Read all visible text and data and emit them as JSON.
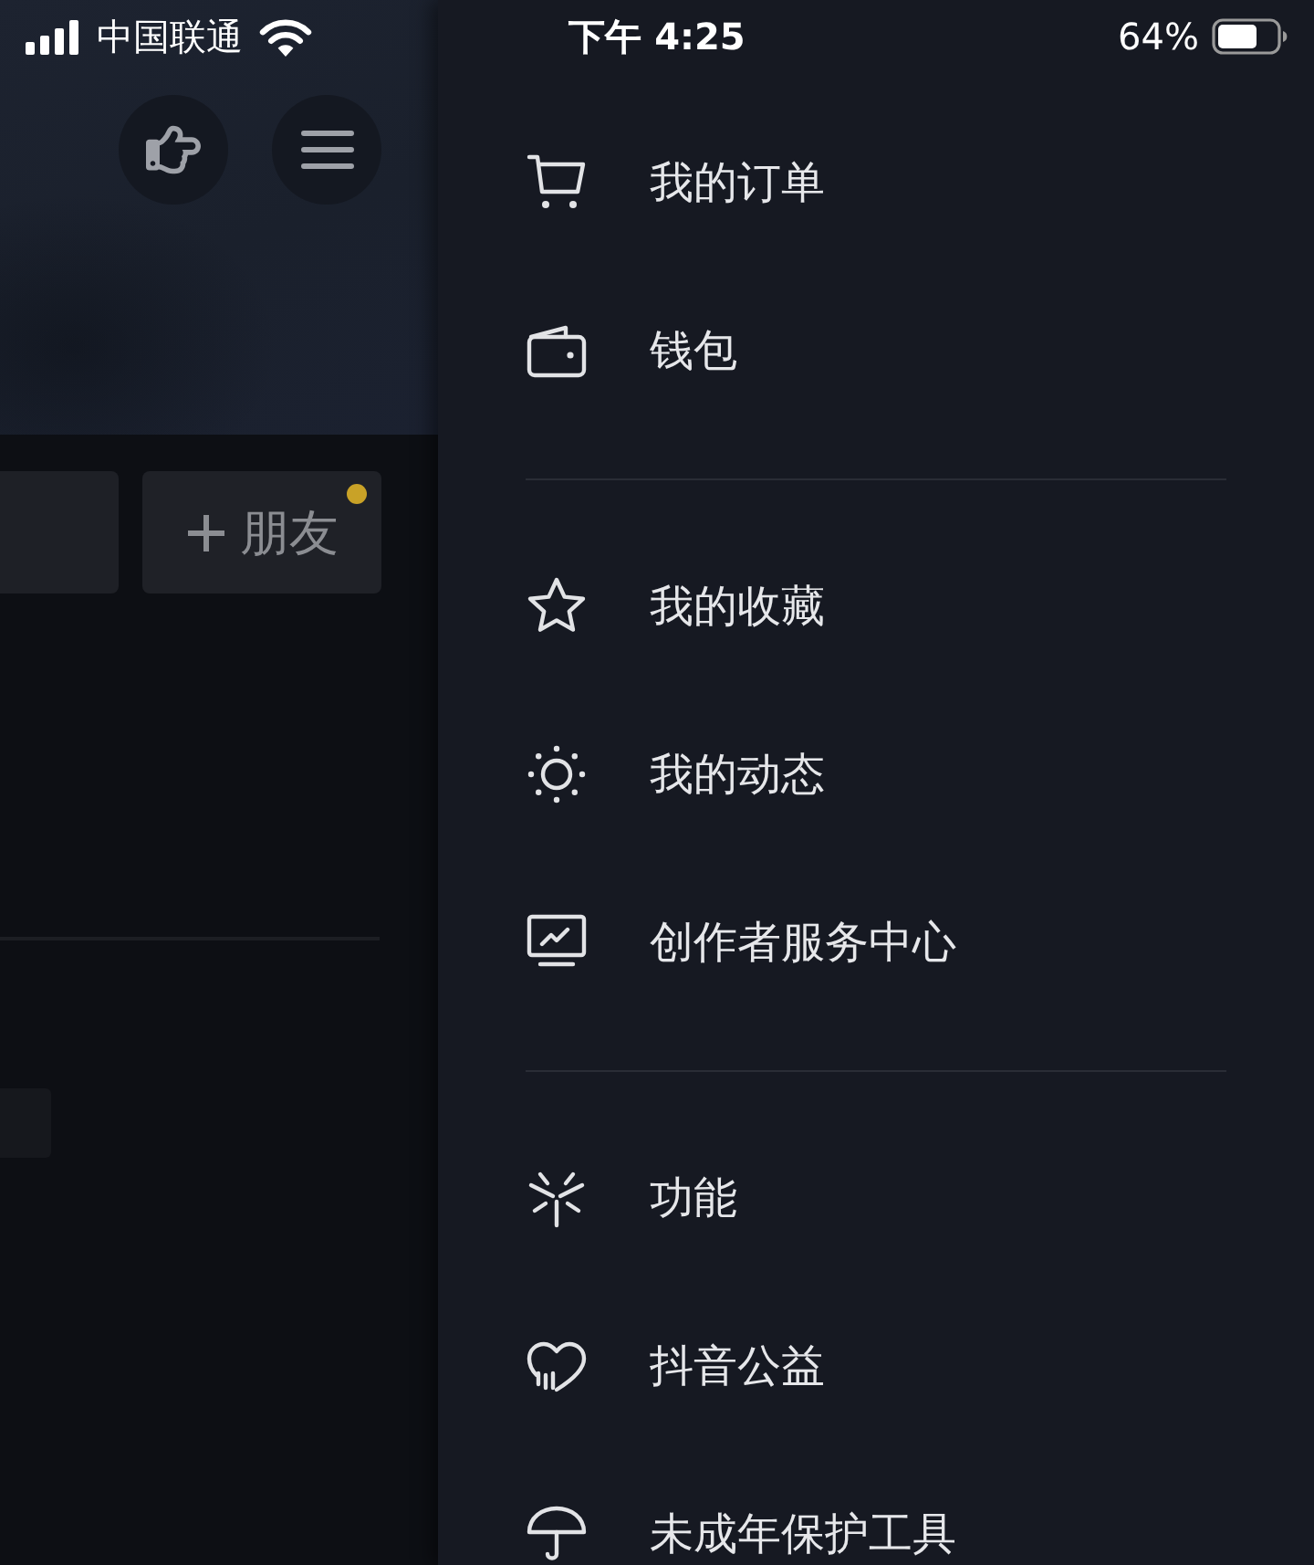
{
  "status_bar": {
    "carrier": "中国联通",
    "time": "下午 4:25",
    "battery": "64%"
  },
  "background_page": {
    "friend_button": {
      "label": "朋友",
      "notification_dot": true
    }
  },
  "drawer": {
    "sections": [
      {
        "items": [
          {
            "label": "我的订单"
          },
          {
            "label": "钱包"
          }
        ]
      },
      {
        "items": [
          {
            "label": "我的收藏"
          },
          {
            "label": "我的动态"
          },
          {
            "label": "创作者服务中心"
          }
        ]
      },
      {
        "items": [
          {
            "label": "功能"
          },
          {
            "label": "抖音公益"
          },
          {
            "label": "未成年保护工具"
          }
        ]
      }
    ]
  }
}
